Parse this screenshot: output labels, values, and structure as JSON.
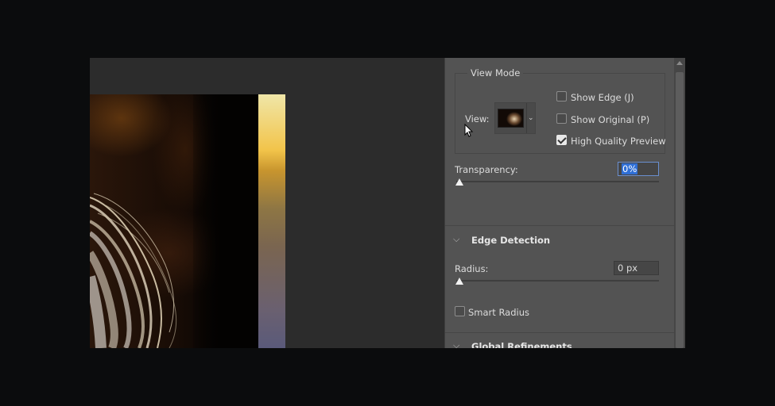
{
  "view_mode": {
    "title": "View Mode",
    "view_label": "View:",
    "options": [
      {
        "label": "Show Edge (J)",
        "checked": false
      },
      {
        "label": "Show Original (P)",
        "checked": false
      },
      {
        "label": "High Quality Preview",
        "checked": true
      }
    ]
  },
  "transparency": {
    "label": "Transparency:",
    "value": "0%",
    "level": 0
  },
  "edge_detection": {
    "title": "Edge Detection",
    "radius_label": "Radius:",
    "radius_value": "0 px",
    "radius_level": 0,
    "smart_radius_label": "Smart Radius",
    "smart_radius_checked": false
  },
  "global_refinements": {
    "title": "Global Refinements"
  },
  "colors": {
    "panel_bg": "#535353",
    "selection_blue": "#2f6fd6"
  }
}
